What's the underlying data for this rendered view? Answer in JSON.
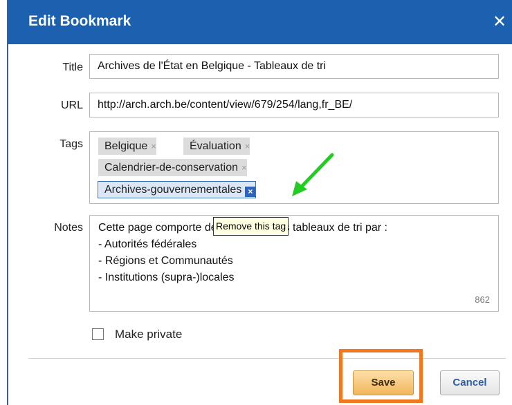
{
  "dialog": {
    "title": "Edit Bookmark",
    "close_glyph": "✕"
  },
  "form": {
    "title_label": "Title",
    "title_value": "Archives de l'État en Belgique - Tableaux de tri",
    "url_label": "URL",
    "url_value": "http://arch.arch.be/content/view/679/254/lang,fr_BE/",
    "tags_label": "Tags",
    "tags": [
      {
        "label": "Belgique",
        "remove_glyph": "×"
      },
      {
        "label": "Évaluation",
        "remove_glyph": "×"
      },
      {
        "label": "Calendrier-de-conservation",
        "remove_glyph": "×"
      },
      {
        "label": "Archives-gouvernementales",
        "remove_glyph": "×"
      }
    ],
    "notes_label": "Notes",
    "notes_lines": [
      "Cette page comporte des liens vers les tableaux de tri par :",
      "- Autorités fédérales",
      "- Régions et Communautés",
      "- Institutions (supra-)locales"
    ],
    "notes_counter": "862",
    "tooltip": "Remove this tag",
    "private_label": "Make private"
  },
  "buttons": {
    "save_label": "Save",
    "cancel_label": "Cancel"
  },
  "colors": {
    "titlebar": "#1c60b0",
    "save_highlight": "#f07920",
    "arrow": "#22cc22",
    "selected_tag_remove": "#2f63b6"
  },
  "icons": {
    "close": "close-icon",
    "remove_tag": "remove-tag-icon",
    "pointer_arrow": "arrow-pointer-icon"
  }
}
